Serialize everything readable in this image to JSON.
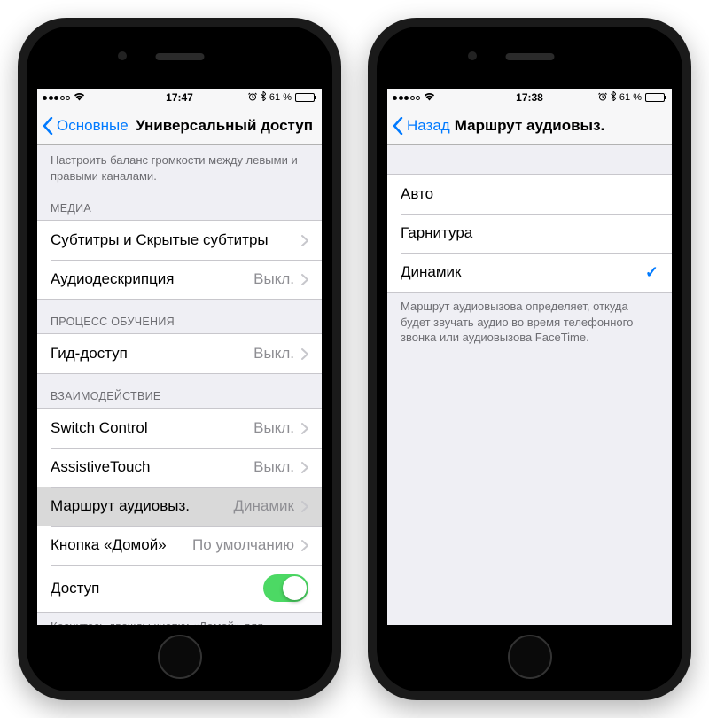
{
  "left": {
    "status": {
      "time": "17:47",
      "battery": "61 %"
    },
    "nav": {
      "back": "Основные",
      "title": "Универсальный доступ"
    },
    "intro": "Настроить баланс громкости между левыми и правыми каналами.",
    "media": {
      "header": "МЕДИА",
      "subtitles": "Субтитры и Скрытые субтитры",
      "audiodesc": {
        "label": "Аудиодескрипция",
        "value": "Выкл."
      }
    },
    "learning": {
      "header": "ПРОЦЕСС ОБУЧЕНИЯ",
      "guided": {
        "label": "Гид-доступ",
        "value": "Выкл."
      }
    },
    "interaction": {
      "header": "ВЗАИМОДЕЙСТВИЕ",
      "switchcontrol": {
        "label": "Switch Control",
        "value": "Выкл."
      },
      "assistive": {
        "label": "AssistiveTouch",
        "value": "Выкл."
      },
      "callroute": {
        "label": "Маршрут аудиовыз.",
        "value": "Динамик"
      },
      "homebutton": {
        "label": "Кнопка «Домой»",
        "value": "По умолчанию"
      },
      "access": {
        "label": "Доступ",
        "on": true
      }
    },
    "footnote": "Коснитесь дважды кнопки «Домой» для получения доступа к верхней части экрана."
  },
  "right": {
    "status": {
      "time": "17:38",
      "battery": "61 %"
    },
    "nav": {
      "back": "Назад",
      "title": "Маршрут аудиовыз."
    },
    "options": {
      "auto": "Авто",
      "headset": "Гарнитура",
      "speaker": "Динамик"
    },
    "footnote": "Маршрут аудиовызова определяет, откуда будет звучать аудио во время телефонного звонка или аудиовызова FaceTime."
  }
}
